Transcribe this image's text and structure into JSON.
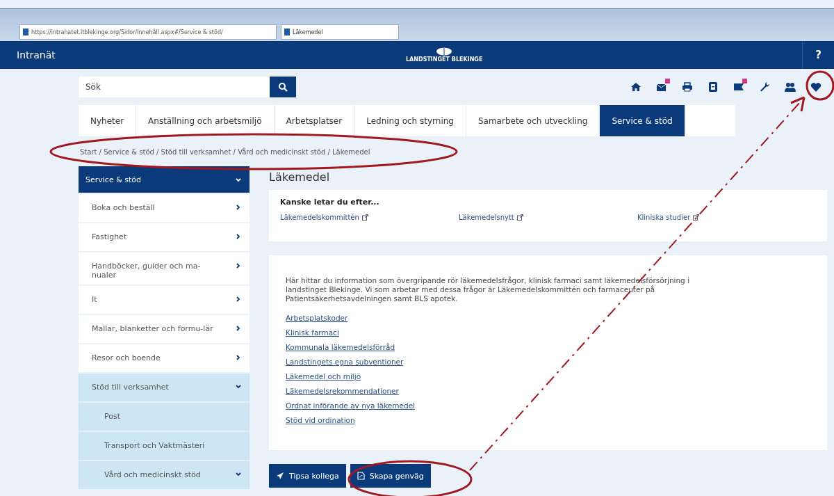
{
  "browser": {
    "address": "https://intranatet.ltblekinge.org/Sidor/Innehåll.aspx#/Service & stöd/",
    "tab_title": "Läkemedel"
  },
  "header": {
    "title": "Intranät",
    "logo_text": "LANDSTINGET BLEKINGE",
    "help": "?"
  },
  "search": {
    "placeholder": "Sök"
  },
  "toolbar": [
    {
      "kind": "home",
      "badge": false
    },
    {
      "kind": "mail",
      "badge": true
    },
    {
      "kind": "print",
      "badge": false
    },
    {
      "kind": "book",
      "badge": false
    },
    {
      "kind": "flag",
      "badge": true
    },
    {
      "kind": "wrench",
      "badge": false
    },
    {
      "kind": "people",
      "badge": false
    },
    {
      "kind": "heart",
      "badge": false
    }
  ],
  "tabs": [
    {
      "label": "Nyheter",
      "selected": false
    },
    {
      "label": "Anställning och arbetsmiljö",
      "selected": false
    },
    {
      "label": "Arbetsplatser",
      "selected": false
    },
    {
      "label": "Ledning och styrning",
      "selected": false
    },
    {
      "label": "Samarbete och utveckling",
      "selected": false
    },
    {
      "label": "Service & stöd",
      "selected": true
    }
  ],
  "breadcrumb": "Start / Service & stöd / Stöd till verksamhet / Vård och medicinskt stöd / Läkemedel",
  "sidebar": {
    "title": "Service & stöd",
    "items": [
      {
        "label": "Boka och beställ",
        "kind": "branch",
        "expanded": false
      },
      {
        "label": "Fastighet",
        "kind": "branch",
        "expanded": false
      },
      {
        "label": "Handböcker, guider och ma-nualer",
        "kind": "branch",
        "expanded": false
      },
      {
        "label": "It",
        "kind": "branch",
        "expanded": false
      },
      {
        "label": "Mallar, blanketter och formu-lär",
        "kind": "branch",
        "expanded": false
      },
      {
        "label": "Resor och boende",
        "kind": "branch",
        "expanded": false
      },
      {
        "label": "Stöd till verksamhet",
        "kind": "branch",
        "expanded": true,
        "children": [
          {
            "label": "Post",
            "kind": "leaf"
          },
          {
            "label": "Transport och Vaktmästeri",
            "kind": "leaf"
          },
          {
            "label": "Vård och medicinskt stöd",
            "kind": "branch",
            "expanded": true
          }
        ]
      }
    ]
  },
  "page_title": "Läkemedel",
  "suggestions": {
    "heading": "Kanske letar du efter...",
    "links": [
      "Läkemedelskommittén",
      "Läkemedelsnytt",
      "Kliniska studier"
    ]
  },
  "intro": "Här hittar du information som övergripande rör läkemedelsfrågor, klinisk farmaci samt läkemedelsförsörjning i landstinget Blekinge. Vi som arbetar med dessa frågor är Läkemedelskommittén och farmaceuter på Patientsäkerhetsavdelningen samt BLS apotek.",
  "links": [
    "Arbetsplatskoder",
    "Klinisk farmaci",
    "Kommunala läkemedelsförråd",
    "Landstingets egna subventioner",
    "Läkemedel och miljö",
    "Läkemedelsrekommendationer",
    "Ordnat införande av nya läkemedel",
    "Stöd vid ordination"
  ],
  "buttons": [
    {
      "label": "Tipsa kollega",
      "kind": "send"
    },
    {
      "label": "Skapa genväg",
      "kind": "shortcut"
    }
  ]
}
